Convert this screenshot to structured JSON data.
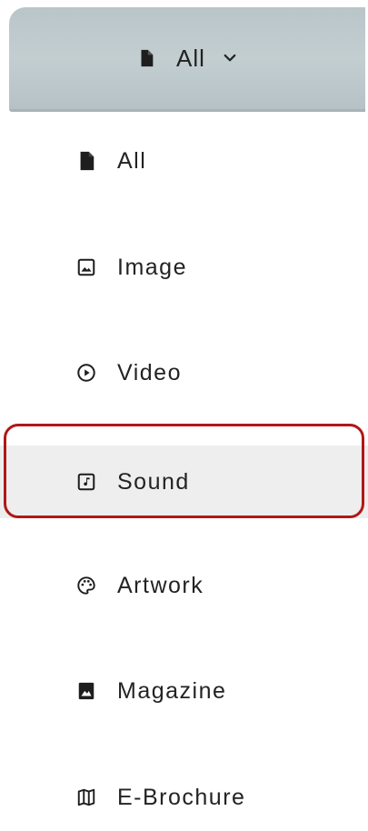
{
  "dropdown": {
    "selected_label": "All",
    "icon": "file-icon",
    "chevron": "chevron-down-icon"
  },
  "menu": {
    "items": [
      {
        "label": "All",
        "icon": "file-icon"
      },
      {
        "label": "Image",
        "icon": "image-icon"
      },
      {
        "label": "Video",
        "icon": "play-circle-icon"
      },
      {
        "label": "Sound",
        "icon": "music-note-icon",
        "selected": true
      },
      {
        "label": "Artwork",
        "icon": "palette-icon"
      },
      {
        "label": "Magazine",
        "icon": "photo-book-icon"
      },
      {
        "label": "E-Brochure",
        "icon": "map-icon"
      }
    ]
  },
  "colors": {
    "header_bg": "#c0cbce",
    "highlight_border": "#b01818",
    "selected_bg": "#eeeeee"
  }
}
